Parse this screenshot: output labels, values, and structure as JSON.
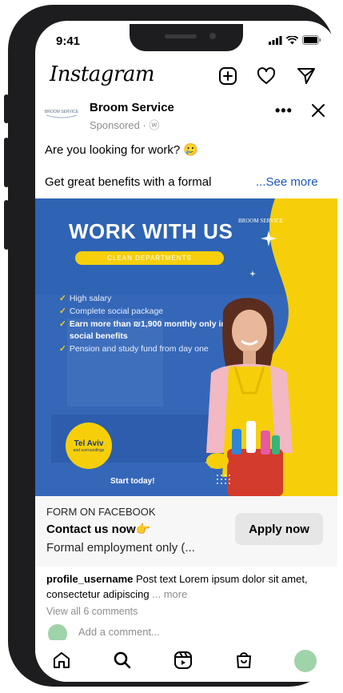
{
  "status": {
    "time": "9:41"
  },
  "header": {
    "logo_text": "Instagram",
    "icons": [
      "new-post-icon",
      "heart-icon",
      "direct-send-icon"
    ]
  },
  "ad": {
    "account": "Broom Service",
    "sponsored": "Sponsored · ⓦ",
    "logo_text": "BROOM SERVICE",
    "text_line1": "Are you looking for work? 🥲",
    "text_line2": "Get great benefits with a formal",
    "see_more": "...See more"
  },
  "creative": {
    "title": "WORK WITH US",
    "brand": "BROOM SERVICE",
    "pill": "CLEAN DEPARTMENTS",
    "benefits": [
      {
        "text": "High salary",
        "bold": false
      },
      {
        "text": "Complete social package",
        "bold": false
      },
      {
        "text": "Earn more than ₪1,900 monthly only in social benefits",
        "bold": true
      },
      {
        "text": "Pension and study fund from day one",
        "bold": false
      }
    ],
    "city": "Tel Aviv",
    "city_sub": "and surroundings",
    "cta": "Start today!",
    "colors": {
      "blue": "#2f63b3",
      "yellow": "#f6cf0a"
    }
  },
  "cta": {
    "label": "FORM ON FACEBOOK",
    "title": "Contact us now👉",
    "subtitle": "Formal employment only (...",
    "button": "Apply now"
  },
  "post": {
    "username": "profile_username",
    "text": " Post text  Lorem ipsum dolor sit amet, consectetur adipiscing ",
    "more": "... more",
    "view_all": "View all 6 comments",
    "comment_placeholder": "Add a comment..."
  },
  "tabbar": {
    "items": [
      "home-icon",
      "search-icon",
      "reels-icon",
      "shop-icon",
      "profile-avatar"
    ]
  }
}
